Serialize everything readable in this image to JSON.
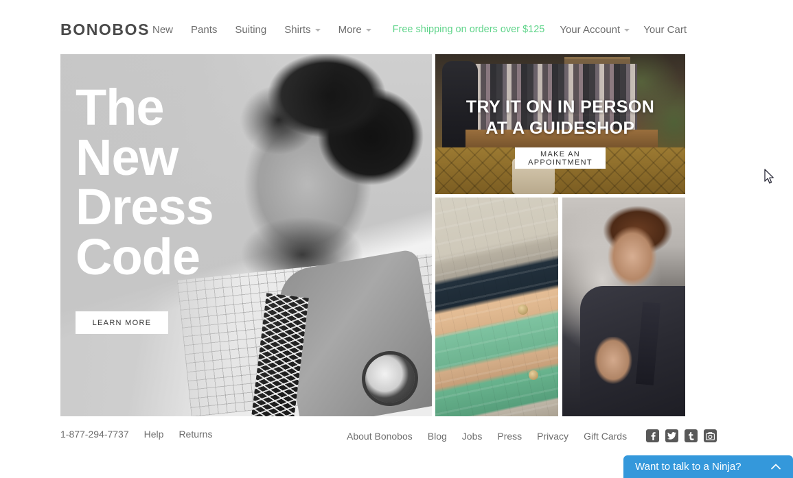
{
  "header": {
    "logo": "BONOBOS",
    "nav_left": [
      {
        "label": "New",
        "caret": false
      },
      {
        "label": "Pants",
        "caret": false
      },
      {
        "label": "Suiting",
        "caret": false
      },
      {
        "label": "Shirts",
        "caret": true
      },
      {
        "label": "More",
        "caret": true
      }
    ],
    "shipping_note": "Free shipping on orders over $125",
    "shipping_color": "#5fd48a",
    "nav_right": [
      {
        "label": "Your Account",
        "caret": true
      },
      {
        "label": "Your Cart",
        "caret": false
      }
    ]
  },
  "hero": {
    "title_lines": [
      "The",
      "New",
      "Dress",
      "Code"
    ],
    "button_label": "LEARN MORE",
    "image_alt": "smiling-man-in-checked-shirt-and-tie-black-and-white"
  },
  "guideshop": {
    "headline_lines": [
      "TRY IT ON IN PERSON",
      "AT A GUIDESHOP"
    ],
    "button_label": "MAKE AN APPOINTMENT",
    "image_alt": "bonobos-guideshop-interior-with-clothing-rack-and-leather-sofa"
  },
  "tiles": [
    {
      "name": "folded-chinos",
      "image_alt": "stack-of-folded-chino-pants-in-khaki-navy-tan-and-mint"
    },
    {
      "name": "man-in-suit",
      "image_alt": "man-adjusting-lapel-of-dark-suit-jacket"
    }
  ],
  "footer": {
    "left_links": [
      "1-877-294-7737",
      "Help",
      "Returns"
    ],
    "right_links": [
      "About Bonobos",
      "Blog",
      "Jobs",
      "Press",
      "Privacy",
      "Gift Cards"
    ],
    "socials": [
      {
        "name": "facebook-icon",
        "glyph": "f"
      },
      {
        "name": "twitter-icon",
        "glyph": "t"
      },
      {
        "name": "tumblr-icon",
        "glyph": "t."
      },
      {
        "name": "instagram-icon",
        "glyph": "camera"
      }
    ]
  },
  "chat": {
    "label": "Want to talk to a Ninja?",
    "color": "#3498db",
    "chevron": "chevron-up"
  }
}
